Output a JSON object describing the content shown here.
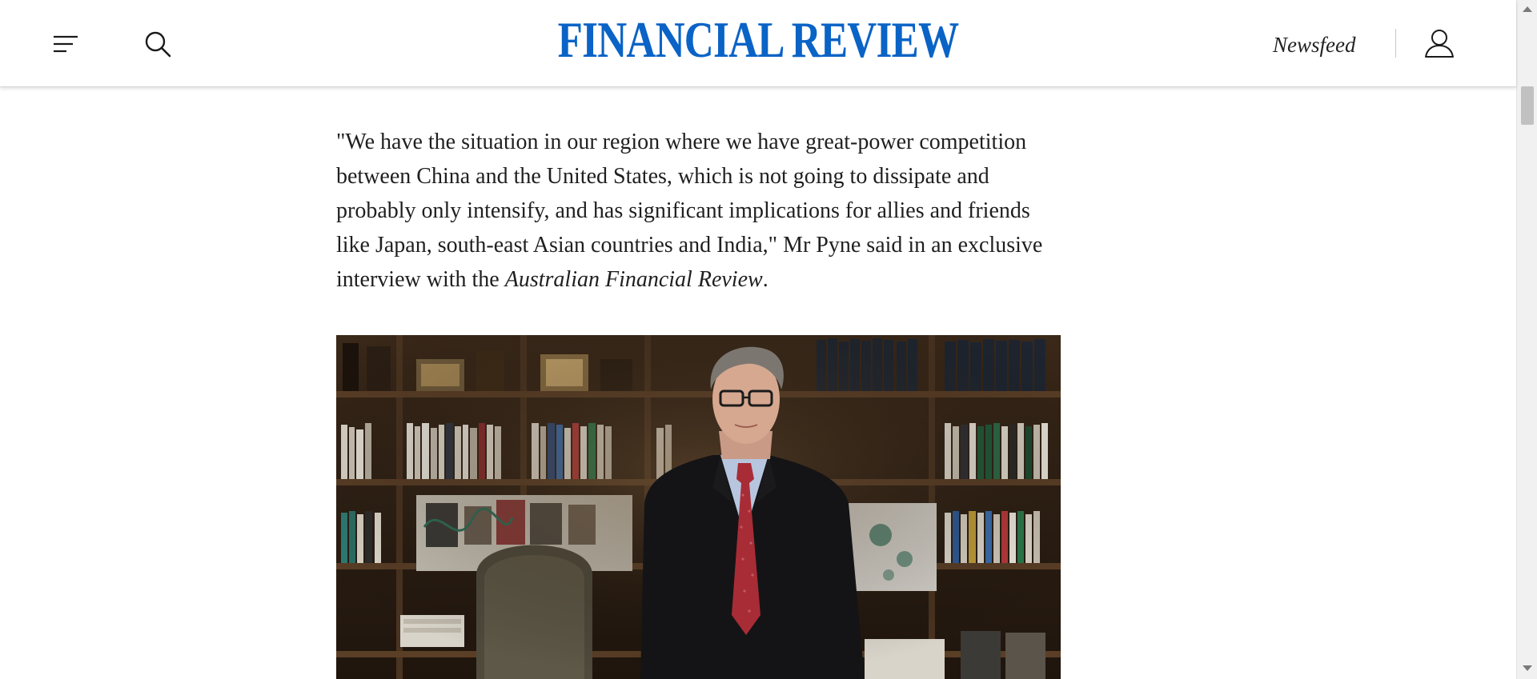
{
  "header": {
    "logo_text": "FINANCIAL REVIEW",
    "newsfeed_label": "Newsfeed",
    "icons": {
      "menu": "menu-icon",
      "search": "search-icon",
      "account": "user-account-icon"
    },
    "brand_color": "#0a63c6"
  },
  "article": {
    "paragraph_main": "\"We have the situation in our region where we have great-power competition between China and the United States, which is not going to dissipate and probably only intensify, and has significant implications for allies and friends like Japan, south-east Asian countries and India,\" Mr Pyne said in an exclusive interview with the ",
    "paragraph_italic": "Australian Financial Review",
    "paragraph_end": "."
  },
  "photo": {
    "subject": "man-in-suit-in-office-portrait"
  }
}
